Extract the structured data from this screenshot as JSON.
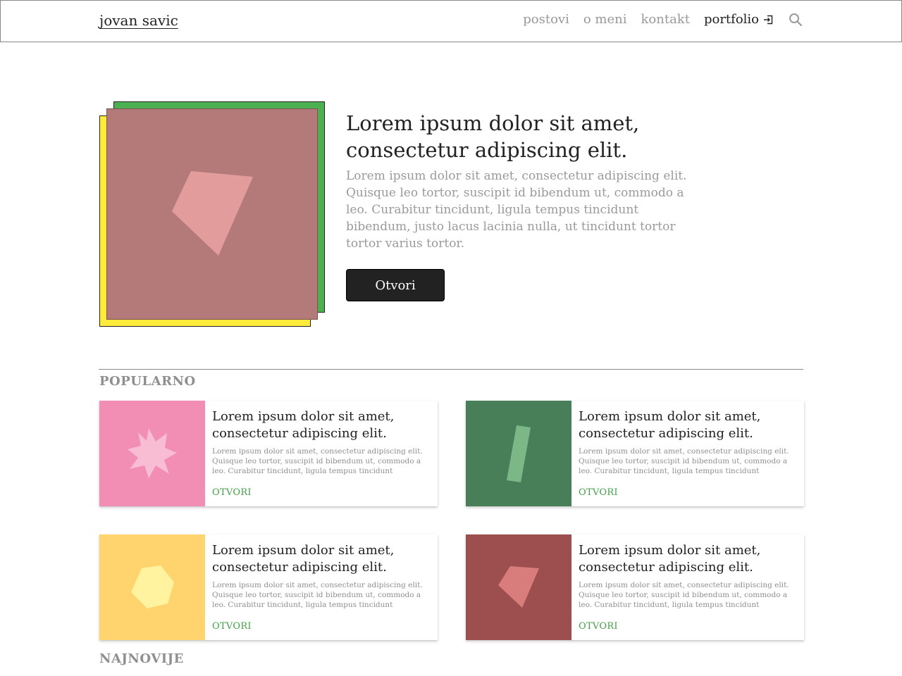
{
  "header": {
    "brand": "jovan savic",
    "nav": [
      "postovi",
      "o meni",
      "kontakt"
    ],
    "portfolio": "portfolio"
  },
  "hero": {
    "title": "Lorem ipsum dolor sit amet, consectetur adipiscing elit.",
    "description": "Lorem ipsum dolor sit amet, consectetur adipiscing elit. Quisque leo tortor, suscipit id bibendum ut, commodo a leo. Curabitur tincidunt, ligula tempus tincidunt bibendum, justo lacus lacinia nulla, ut tincidunt tortor tortor varius tortor.",
    "button": "Otvori",
    "colors": {
      "back_left": "#ffeb3b",
      "back_right": "#4caf50",
      "front": "#b47a79",
      "shape": "#e29c9c"
    }
  },
  "popular": {
    "heading": "POPULARNO",
    "cards": [
      {
        "title": "Lorem ipsum dolor sit amet, consectetur adipiscing elit.",
        "description": "Lorem ipsum dolor sit amet, consectetur adipiscing elit. Quisque leo tortor, suscipit id bibendum ut, commodo a leo. Curabitur tincidunt, ligula tempus tincidunt",
        "link": "OTVORI",
        "bg": "#f28db4",
        "shape": "starburst",
        "shape_color": "#f8bcd3"
      },
      {
        "title": "Lorem ipsum dolor sit amet, consectetur adipiscing elit.",
        "description": "Lorem ipsum dolor sit amet, consectetur adipiscing elit. Quisque leo tortor, suscipit id bibendum ut, commodo a leo. Curabitur tincidunt, ligula tempus tincidunt",
        "link": "OTVORI",
        "bg": "#487f58",
        "shape": "bar",
        "shape_color": "#7cb887"
      },
      {
        "title": "Lorem ipsum dolor sit amet, consectetur adipiscing elit.",
        "description": "Lorem ipsum dolor sit amet, consectetur adipiscing elit. Quisque leo tortor, suscipit id bibendum ut, commodo a leo. Curabitur tincidunt, ligula tempus tincidunt",
        "link": "OTVORI",
        "bg": "#ffd46e",
        "shape": "hexagon",
        "shape_color": "#fff3a0"
      },
      {
        "title": "Lorem ipsum dolor sit amet, consectetur adipiscing elit.",
        "description": "Lorem ipsum dolor sit amet, consectetur adipiscing elit. Quisque leo tortor, suscipit id bibendum ut, commodo a leo. Curabitur tincidunt, ligula tempus tincidunt",
        "link": "OTVORI",
        "bg": "#9d4e4e",
        "shape": "quadrilateral",
        "shape_color": "#d97c7c"
      }
    ]
  },
  "latest": {
    "heading": "NAJNOVIJE"
  }
}
